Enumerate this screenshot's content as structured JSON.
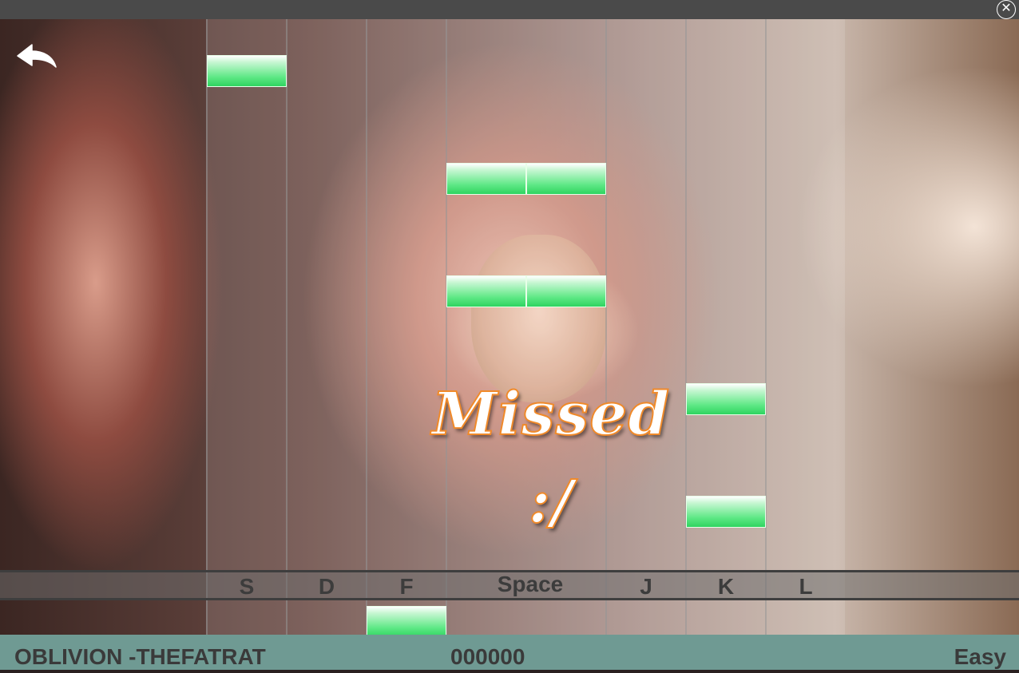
{
  "window": {
    "close_icon": "close-circle-icon"
  },
  "game": {
    "back_icon": "back-arrow-icon",
    "feedback_text": "Missed :/",
    "note_color": "#3ad86a",
    "feedback_color": "#f08a2a"
  },
  "keys": [
    "S",
    "D",
    "F",
    "Space",
    "J",
    "K",
    "L"
  ],
  "status": {
    "song": "OBLIVION -THEFATRAT",
    "score": "000000",
    "difficulty": "Easy"
  }
}
